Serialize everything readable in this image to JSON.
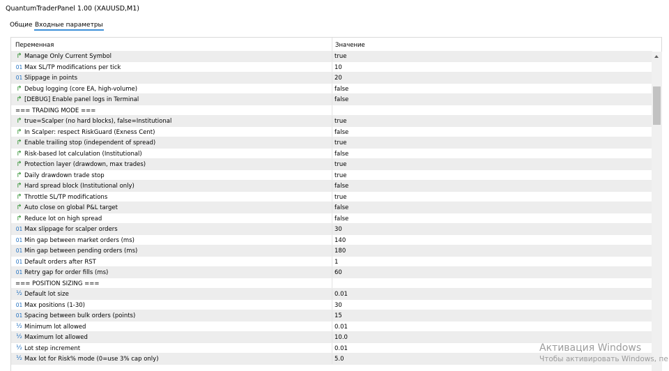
{
  "window": {
    "title": "QuantumTraderPanel 1.00 (XAUUSD,M1)"
  },
  "tabs": [
    {
      "label": "Общие"
    },
    {
      "label": "Входные параметры"
    }
  ],
  "table": {
    "headers": {
      "variable": "Переменная",
      "value": "Значение"
    },
    "rows": [
      {
        "icon": "arrow",
        "glyph": "↱",
        "name": "Manage Only Current Symbol",
        "value": "true"
      },
      {
        "icon": "int",
        "glyph": "01",
        "name": "Max SL/TP modifications per tick",
        "value": "10"
      },
      {
        "icon": "int",
        "glyph": "01",
        "name": "Slippage in points",
        "value": "20"
      },
      {
        "icon": "arrow",
        "glyph": "↱",
        "name": "Debug logging (core EA, high-volume)",
        "value": "false"
      },
      {
        "icon": "arrow",
        "glyph": "↱",
        "name": "[DEBUG] Enable panel logs in Terminal",
        "value": "false"
      },
      {
        "icon": "none",
        "glyph": "",
        "name": "=== TRADING MODE ===",
        "value": ""
      },
      {
        "icon": "arrow",
        "glyph": "↱",
        "name": "true=Scalper (no hard blocks), false=Institutional",
        "value": "true"
      },
      {
        "icon": "arrow",
        "glyph": "↱",
        "name": "In Scalper: respect RiskGuard (Exness Cent)",
        "value": "false"
      },
      {
        "icon": "arrow",
        "glyph": "↱",
        "name": "Enable trailing stop (independent of spread)",
        "value": "true"
      },
      {
        "icon": "arrow",
        "glyph": "↱",
        "name": "Risk-based lot calculation (Institutional)",
        "value": "false"
      },
      {
        "icon": "arrow",
        "glyph": "↱",
        "name": "Protection layer (drawdown, max trades)",
        "value": "true"
      },
      {
        "icon": "arrow",
        "glyph": "↱",
        "name": "Daily drawdown trade stop",
        "value": "true"
      },
      {
        "icon": "arrow",
        "glyph": "↱",
        "name": "Hard spread block (Institutional only)",
        "value": "false"
      },
      {
        "icon": "arrow",
        "glyph": "↱",
        "name": "Throttle SL/TP modifications",
        "value": "true"
      },
      {
        "icon": "arrow",
        "glyph": "↱",
        "name": "Auto close on global P&L target",
        "value": "false"
      },
      {
        "icon": "arrow",
        "glyph": "↱",
        "name": "Reduce lot on high spread",
        "value": "false"
      },
      {
        "icon": "int",
        "glyph": "01",
        "name": "Max slippage for scalper orders",
        "value": "30"
      },
      {
        "icon": "int",
        "glyph": "01",
        "name": "Min gap between market orders (ms)",
        "value": "140"
      },
      {
        "icon": "int",
        "glyph": "01",
        "name": "Min gap between pending orders (ms)",
        "value": "180"
      },
      {
        "icon": "int",
        "glyph": "01",
        "name": "Default orders after RST",
        "value": "1"
      },
      {
        "icon": "int",
        "glyph": "01",
        "name": "Retry gap for order fills (ms)",
        "value": "60"
      },
      {
        "icon": "none",
        "glyph": "",
        "name": "=== POSITION SIZING ===",
        "value": ""
      },
      {
        "icon": "half",
        "glyph": "½",
        "name": "Default lot size",
        "value": "0.01"
      },
      {
        "icon": "int",
        "glyph": "01",
        "name": "Max positions (1-30)",
        "value": "30"
      },
      {
        "icon": "int",
        "glyph": "01",
        "name": "Spacing between bulk orders (points)",
        "value": "15"
      },
      {
        "icon": "half",
        "glyph": "½",
        "name": "Minimum lot allowed",
        "value": "0.01"
      },
      {
        "icon": "half",
        "glyph": "½",
        "name": "Maximum lot allowed",
        "value": "10.0"
      },
      {
        "icon": "half",
        "glyph": "½",
        "name": "Lot step increment",
        "value": "0.01"
      },
      {
        "icon": "half",
        "glyph": "½",
        "name": "Max lot for Risk% mode (0=use 3% cap only)",
        "value": "5.0"
      }
    ]
  },
  "watermark": {
    "line1": "Активация Windows",
    "line2": "Чтобы активировать Windows, пе"
  },
  "colors": {
    "tab_underline": "#3c8fd8",
    "arrow_icon": "#2d8f2d",
    "int_icon": "#1f6fbf",
    "alt_row": "#ededed"
  }
}
